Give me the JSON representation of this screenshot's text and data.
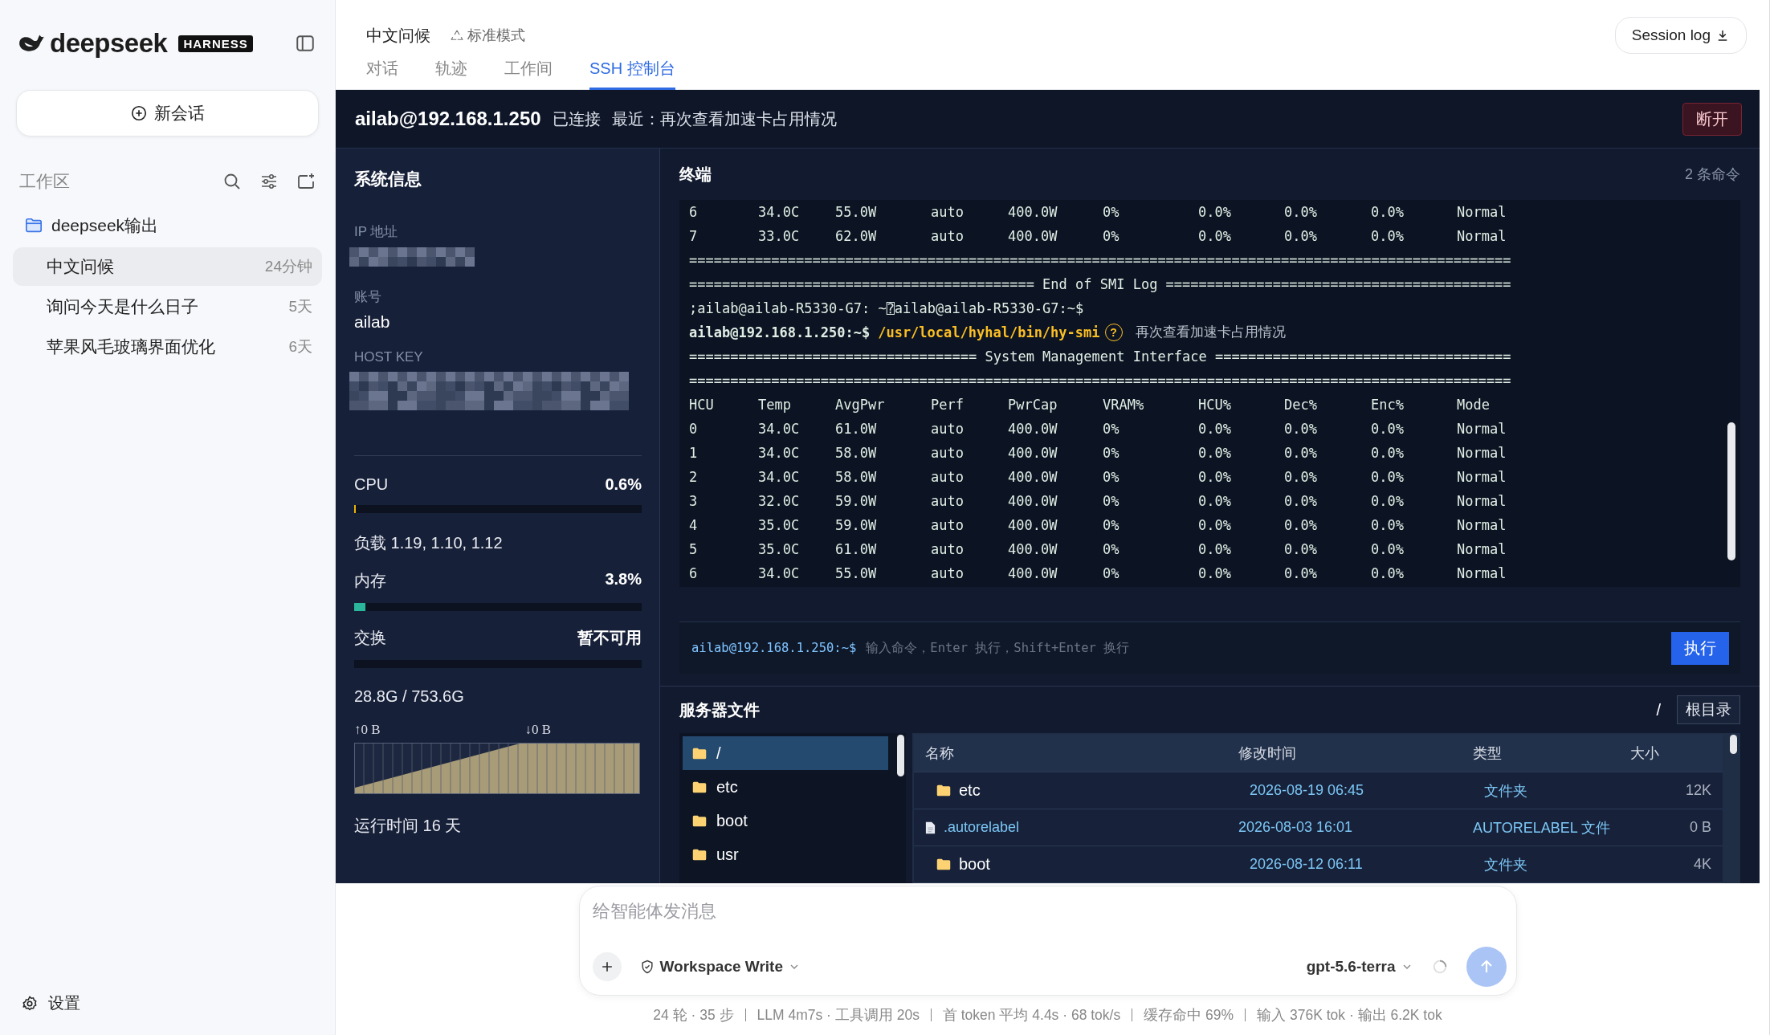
{
  "sidebar": {
    "logo": {
      "wordmark": "deepseek",
      "badge": "HARNESS"
    },
    "new_chat": "新会话",
    "workspace_label": "工作区",
    "folders": [
      {
        "name": "deepseek输出",
        "items": [
          {
            "title": "中文问候",
            "time": "24分钟",
            "selected": true
          },
          {
            "title": "询问今天是什么日子",
            "time": "5天",
            "selected": false
          },
          {
            "title": "苹果风毛玻璃界面优化",
            "time": "6天",
            "selected": false
          }
        ]
      }
    ],
    "settings": "设置"
  },
  "header": {
    "title": "中文问候",
    "mode": "标准模式",
    "session_log": "Session log",
    "tabs": [
      {
        "label": "对话",
        "selected": false
      },
      {
        "label": "轨迹",
        "selected": false
      },
      {
        "label": "工作间",
        "selected": false
      },
      {
        "label": "SSH 控制台",
        "selected": true
      }
    ]
  },
  "ssh": {
    "host": "ailab@192.168.1.250",
    "status": "已连接",
    "recent": "最近：再次查看加速卡占用情况",
    "disconnect": "断开",
    "system": {
      "title": "系统信息",
      "ip_label": "IP 地址",
      "account_label": "账号",
      "account": "ailab",
      "host_key_label": "HOST KEY",
      "meters": [
        {
          "label": "CPU",
          "value": "0.6%",
          "level": 0.006,
          "color": "#eab308",
          "note": "负载 1.19, 1.10, 1.12"
        },
        {
          "label": "内存",
          "value": "3.8%",
          "level": 0.038,
          "color": "#2bb59a"
        },
        {
          "label": "交换",
          "value": "暂不可用",
          "note": "28.8G / 753.6G"
        }
      ],
      "traffic": {
        "up": "↑0 B",
        "down": "↓0 B"
      },
      "uptime": "运行时间 16 天"
    },
    "terminal": {
      "title": "终端",
      "count": "2 条命令",
      "lines": [
        {
          "kind": "row",
          "cells": [
            "6",
            "34.0C",
            "55.0W",
            "auto",
            "400.0W",
            "0%",
            "0.0%",
            "0.0%",
            "0.0%",
            "Normal"
          ]
        },
        {
          "kind": "row",
          "cells": [
            "7",
            "33.0C",
            "62.0W",
            "auto",
            "400.0W",
            "0%",
            "0.0%",
            "0.0%",
            "0.0%",
            "Normal"
          ]
        },
        {
          "kind": "text",
          "text": "===================================================================================================="
        },
        {
          "kind": "text",
          "text": "========================================== End of SMI Log =========================================="
        },
        {
          "kind": "text",
          "text": ";ailab@ailab-R5330-G7: ~⍰ailab@ailab-R5330-G7:~$"
        },
        {
          "kind": "command",
          "prompt": "ailab@192.168.1.250:~$",
          "command": "/usr/local/hyhal/bin/hy-smi",
          "badge": "?",
          "note": "再次查看加速卡占用情况"
        },
        {
          "kind": "text",
          "text": "=================================== System Management Interface ===================================="
        },
        {
          "kind": "text",
          "text": "===================================================================================================="
        },
        {
          "kind": "row",
          "cells": [
            "HCU",
            "Temp",
            "AvgPwr",
            "Perf",
            "PwrCap",
            "VRAM%",
            "HCU%",
            "Dec%",
            "Enc%",
            "Mode"
          ]
        },
        {
          "kind": "row",
          "cells": [
            "0",
            "34.0C",
            "61.0W",
            "auto",
            "400.0W",
            "0%",
            "0.0%",
            "0.0%",
            "0.0%",
            "Normal"
          ]
        },
        {
          "kind": "row",
          "cells": [
            "1",
            "34.0C",
            "58.0W",
            "auto",
            "400.0W",
            "0%",
            "0.0%",
            "0.0%",
            "0.0%",
            "Normal"
          ]
        },
        {
          "kind": "row",
          "cells": [
            "2",
            "34.0C",
            "58.0W",
            "auto",
            "400.0W",
            "0%",
            "0.0%",
            "0.0%",
            "0.0%",
            "Normal"
          ]
        },
        {
          "kind": "row",
          "cells": [
            "3",
            "32.0C",
            "59.0W",
            "auto",
            "400.0W",
            "0%",
            "0.0%",
            "0.0%",
            "0.0%",
            "Normal"
          ]
        },
        {
          "kind": "row",
          "cells": [
            "4",
            "35.0C",
            "59.0W",
            "auto",
            "400.0W",
            "0%",
            "0.0%",
            "0.0%",
            "0.0%",
            "Normal"
          ]
        },
        {
          "kind": "row",
          "cells": [
            "5",
            "35.0C",
            "61.0W",
            "auto",
            "400.0W",
            "0%",
            "0.0%",
            "0.0%",
            "0.0%",
            "Normal"
          ]
        },
        {
          "kind": "row",
          "cells": [
            "6",
            "34.0C",
            "55.0W",
            "auto",
            "400.0W",
            "0%",
            "0.0%",
            "0.0%",
            "0.0%",
            "Normal"
          ]
        }
      ],
      "input": {
        "prompt": "ailab@192.168.1.250:~$",
        "placeholder": "输入命令，Enter 执行，Shift+Enter 换行",
        "run": "执行"
      }
    },
    "files": {
      "title": "服务器文件",
      "path": "/",
      "root_button": "根目录",
      "tree": [
        {
          "name": "/",
          "selected": true
        },
        {
          "name": "etc",
          "selected": false
        },
        {
          "name": "boot",
          "selected": false
        },
        {
          "name": "usr",
          "selected": false
        }
      ],
      "columns": [
        "名称",
        "修改时间",
        "类型",
        "大小"
      ],
      "rows": [
        {
          "kind": "folder",
          "name": "etc",
          "modified": "2026-08-19 06:45",
          "type": "文件夹",
          "size": "12K"
        },
        {
          "kind": "file",
          "name": ".autorelabel",
          "modified": "2026-08-03 16:01",
          "type": "AUTORELABEL 文件",
          "size": "0 B"
        },
        {
          "kind": "folder",
          "name": "boot",
          "modified": "2026-08-12 06:11",
          "type": "文件夹",
          "size": "4K"
        }
      ]
    }
  },
  "composer": {
    "placeholder": "给智能体发消息",
    "permission": "Workspace Write",
    "model": "gpt-5.6-terra"
  },
  "stats": [
    "24 轮 · 35 步",
    "LLM 4m7s · 工具调用 20s",
    "首 token 平均 4.4s · 68 tok/s",
    "缓存命中 69%",
    "输入 376K tok · 输出 6.2K tok"
  ]
}
